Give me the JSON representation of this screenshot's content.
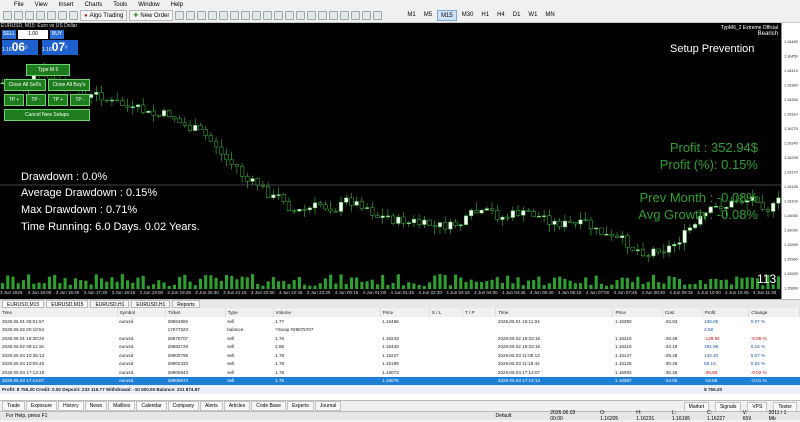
{
  "menu": [
    "File",
    "View",
    "Insert",
    "Charts",
    "Tools",
    "Window",
    "Help"
  ],
  "toolbar": {
    "algo_trading": "Algo Trading",
    "new_order": "New Order",
    "timeframes": [
      "M1",
      "M5",
      "M15",
      "M30",
      "H1",
      "H4",
      "D1",
      "W1",
      "MN"
    ],
    "active_timeframe": "M15"
  },
  "chart": {
    "symbol_line": "EURUSD, M15: Euro vs US Dollar",
    "sell_label": "SELL",
    "buy_label": "BUY",
    "lot": "1.00",
    "bid_prefix": "1.16",
    "bid_big": "06",
    "bid_sup": "3",
    "ask_prefix": "1.16",
    "ask_big": "07",
    "ask_sup": "0",
    "panel_buttons": {
      "type": "Type M 6",
      "close_sells": "Close All Sell's",
      "close_buys": "Close All Buy's",
      "tp1": "TP +",
      "tp2": "TP -",
      "tp3": "TP +",
      "tp4": "TP -",
      "cancel": "Cancel New Setups"
    },
    "ea_name": "TypM6_2 Extreme Official",
    "trend": "Bearish",
    "setup_title": "Setup Prevention",
    "stats": {
      "drawdown": "Drawdown : 0.0%",
      "avg_drawdown": "Average Drawdown : 0.15%",
      "max_drawdown": "Max Drawdown : 0.71%",
      "time_running": "Time Running: 6.0 Days. 0.02 Years."
    },
    "profit": {
      "profit": "Profit : 352.94$",
      "profit_pct": "Profit (%): 0.15%",
      "prev_month": "Prev Month : -0.08%",
      "avg_growth": "Avg Growth : -0.08%"
    },
    "counter": "113",
    "price_ticks": [
      "1.16485",
      "1.16450",
      "1.16415",
      "1.16380",
      "1.16345",
      "1.16310",
      "1.16275",
      "1.16240",
      "1.16205",
      "1.16170",
      "1.16135",
      "1.16100",
      "1.16065",
      "1.16030",
      "1.15995",
      "1.15960",
      "1.15925",
      "1.15890"
    ],
    "time_ticks": [
      "3 Jun 2026",
      "3 Jun 16:00",
      "3 Jun 16:45",
      "3 Jun 17:30",
      "3 Jun 18:15",
      "3 Jun 19:00",
      "3 Jun 19:45",
      "3 Jun 20:30",
      "3 Jun 21:15",
      "3 Jun 22:00",
      "3 Jun 22:45",
      "3 Jun 23:30",
      "4 Jun 00:15",
      "4 Jun 01:00",
      "4 Jun 01:45",
      "4 Jun 02:30",
      "4 Jun 03:15",
      "4 Jun 04:00",
      "4 Jun 04:45",
      "4 Jun 05:30",
      "4 Jun 06:15",
      "4 Jun 07:00",
      "4 Jun 07:45",
      "4 Jun 08:30",
      "4 Jun 09:15",
      "4 Jun 10:00",
      "4 Jun 10:45",
      "4 Jun 11:30"
    ]
  },
  "chart_tabs": [
    "EURUSD,M15",
    "EURUSD,M15",
    "EURUSD,H1",
    "EURUSD,H1",
    "Reports"
  ],
  "history": {
    "columns": [
      "Time",
      "Symbol",
      "Ticket",
      "Type",
      "Volume",
      "Price",
      "S / L",
      "T / P",
      "Time",
      "Price",
      "Cost",
      "Profit",
      "Change"
    ],
    "rows": [
      [
        "2026.06.01 06:01:57",
        "eurusd",
        "28864960",
        "sell",
        "1.77",
        "1.16468",
        "",
        "",
        "2026.06.01 16:11:04",
        "1.16390",
        "-33.63",
        "138.06",
        "0.07 %"
      ],
      [
        "2026.06.02 00:10:54",
        "",
        "17677623",
        "balance",
        "?Swap #28875707",
        "",
        "",
        "",
        "",
        "",
        "",
        "2.58",
        ""
      ],
      [
        "2026.06.01 18:30:26",
        "eurusd",
        "28875707",
        "sell",
        "1.78",
        "1.16243",
        "",
        "",
        "2026.06.02 19:33:16",
        "1.16316",
        "-28.48",
        "-129.94",
        "-0.05 %"
      ],
      [
        "2026.06.02 09:11:15",
        "eurusd",
        "28883728",
        "sell",
        "2.85",
        "1.16443",
        "",
        "",
        "2026.06.02 19:33:16",
        "1.16316",
        "-44.18",
        "361.95",
        "0.15 %"
      ],
      [
        "2026.06.03 10:35:13",
        "eurusd",
        "28900795",
        "sell",
        "1.78",
        "1.16227",
        "",
        "",
        "2026.06.03 11:08:13",
        "1.16147",
        "-28.48",
        "142.40",
        "0.07 %"
      ],
      [
        "2026.06.03 10:05:46",
        "eurusd",
        "28902333",
        "sell",
        "1.78",
        "1.16189",
        "",
        "",
        "2026.06.03 11:18:44",
        "1.16126",
        "-30.26",
        "80.10",
        "0.04 %"
      ],
      [
        "2026.06.03 17:13:19",
        "eurusd",
        "28906543",
        "sell",
        "1.78",
        "1.16073",
        "",
        "",
        "2026.06.03 17:14:07",
        "1.16093",
        "-30.26",
        "-35.60",
        "-0.02 %"
      ],
      [
        "2026.06.03 17:14:07",
        "eurusd",
        "28906574",
        "sell",
        "1.78",
        "1.16076",
        "",
        "",
        "2026.06.03 17:14:13",
        "1.16087",
        "-24.05",
        "-19.58",
        "-0.01 %"
      ]
    ],
    "summary": "Profit: 8 755.20  Credit: 0.00  Deposit: 233 119.77  Withdrawal: -10 000.00  Balance: 231 874.97",
    "summary_total": "8 755.20"
  },
  "bottom_tabs": [
    "Trade",
    "Exposure",
    "History",
    "News",
    "Mailbox",
    "Calendar",
    "Company",
    "Alerts",
    "Articles",
    "Code Base",
    "Experts",
    "Journal"
  ],
  "active_bottom_tab": "History",
  "right_tools": [
    "Market",
    "Signals",
    "VPS",
    "Tester"
  ],
  "status": {
    "help": "For Help, press F1",
    "profile": "Default",
    "date": "2026.06.03 00:00",
    "open": "O: 1.16205",
    "high": "H: 1.16231",
    "low": "L: 1.16195",
    "close": "C: 1.16227",
    "volume": "V: 659",
    "traffic": "2011 / 1 Mb"
  }
}
